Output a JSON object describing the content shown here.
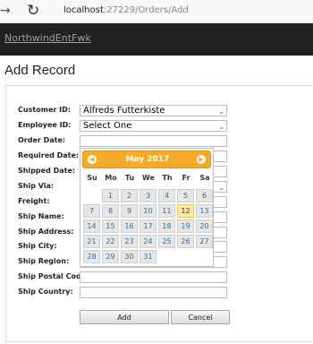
{
  "browser": {
    "url_host": "localhost",
    "url_path": ":27229/Orders/Add"
  },
  "nav": {
    "brand": "NorthwindEntFwk"
  },
  "page": {
    "heading": "Add Record"
  },
  "form": {
    "labels": [
      "Customer ID:",
      "Employee ID:",
      "Order Date:",
      "Required Date:",
      "Shipped Date:",
      "Ship Via:",
      "Freight:",
      "Ship Name:",
      "Ship Address:",
      "Ship City:",
      "Ship Region:",
      "Ship Postal Code:",
      "Ship Country:"
    ],
    "customer_value": "Alfreds Futterkiste",
    "employee_value": "Select One",
    "add_label": "Add",
    "cancel_label": "Cancel"
  },
  "calendar": {
    "title": "May 2017",
    "prev": "◀",
    "next": "▶",
    "weekdays": [
      "Su",
      "Mo",
      "Tu",
      "We",
      "Th",
      "Fr",
      "Sa"
    ],
    "weeks": [
      [
        "",
        "1",
        "2",
        "3",
        "4",
        "5",
        "6"
      ],
      [
        "7",
        "8",
        "9",
        "10",
        "11",
        "12",
        "13"
      ],
      [
        "14",
        "15",
        "16",
        "17",
        "18",
        "19",
        "20"
      ],
      [
        "21",
        "22",
        "23",
        "24",
        "25",
        "26",
        "27"
      ],
      [
        "28",
        "29",
        "30",
        "31",
        "",
        "",
        ""
      ]
    ],
    "selected": "12"
  },
  "colors": {
    "navbar": "#222222",
    "calendar_header": "#f7a928",
    "today": "#fce9a6",
    "day_text": "#2e6fa7"
  }
}
